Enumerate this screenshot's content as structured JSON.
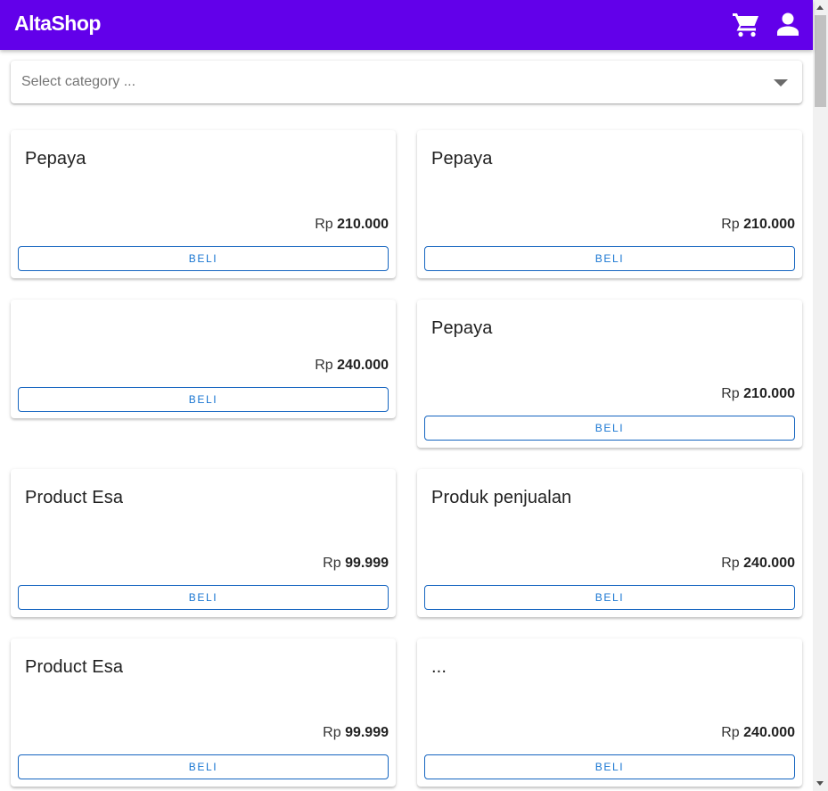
{
  "app": {
    "brand": "AltaShop",
    "brand_color": "#6200ea",
    "icons": {
      "cart": "cart-icon",
      "user": "user-icon"
    }
  },
  "filter": {
    "placeholder": "Select category ...",
    "icon": "chevron-down-icon"
  },
  "products": [
    {
      "name": "Pepaya",
      "currency": "Rp",
      "price": "210.000",
      "button": "BELI"
    },
    {
      "name": "Pepaya",
      "currency": "Rp",
      "price": "210.000",
      "button": "BELI"
    },
    {
      "name": "",
      "currency": "Rp",
      "price": "240.000",
      "button": "BELI"
    },
    {
      "name": "Pepaya",
      "currency": "Rp",
      "price": "210.000",
      "button": "BELI"
    },
    {
      "name": "Product Esa",
      "currency": "Rp",
      "price": "99.999",
      "button": "BELI"
    },
    {
      "name": "Produk penjualan",
      "currency": "Rp",
      "price": "240.000",
      "button": "BELI"
    },
    {
      "name": "Product Esa",
      "currency": "Rp",
      "price": "99.999",
      "button": "BELI"
    },
    {
      "name": "...",
      "currency": "Rp",
      "price": "240.000",
      "button": "BELI"
    }
  ]
}
